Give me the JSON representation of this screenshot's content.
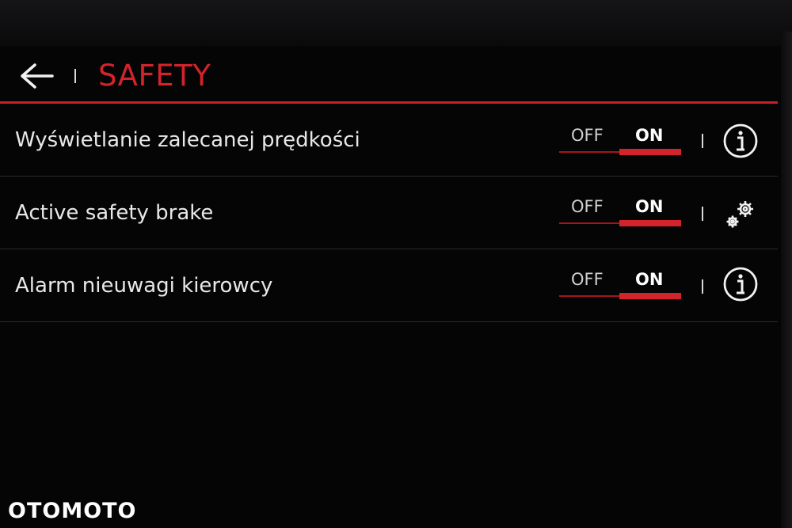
{
  "header": {
    "title": "SAFETY"
  },
  "rows": [
    {
      "label": "Wyświetlanie zalecanej prędkości",
      "off_label": "OFF",
      "on_label": "ON",
      "state": "ON",
      "action_icon": "info-icon"
    },
    {
      "label": "Active safety brake",
      "off_label": "OFF",
      "on_label": "ON",
      "state": "ON",
      "action_icon": "gears-icon"
    },
    {
      "label": "Alarm nieuwagi kierowcy",
      "off_label": "OFF",
      "on_label": "ON",
      "state": "ON",
      "action_icon": "info-icon"
    }
  ],
  "colors": {
    "accent": "#d3232b",
    "background": "#050506",
    "text": "#e8e8e8"
  },
  "watermark": "OTOMOTO"
}
